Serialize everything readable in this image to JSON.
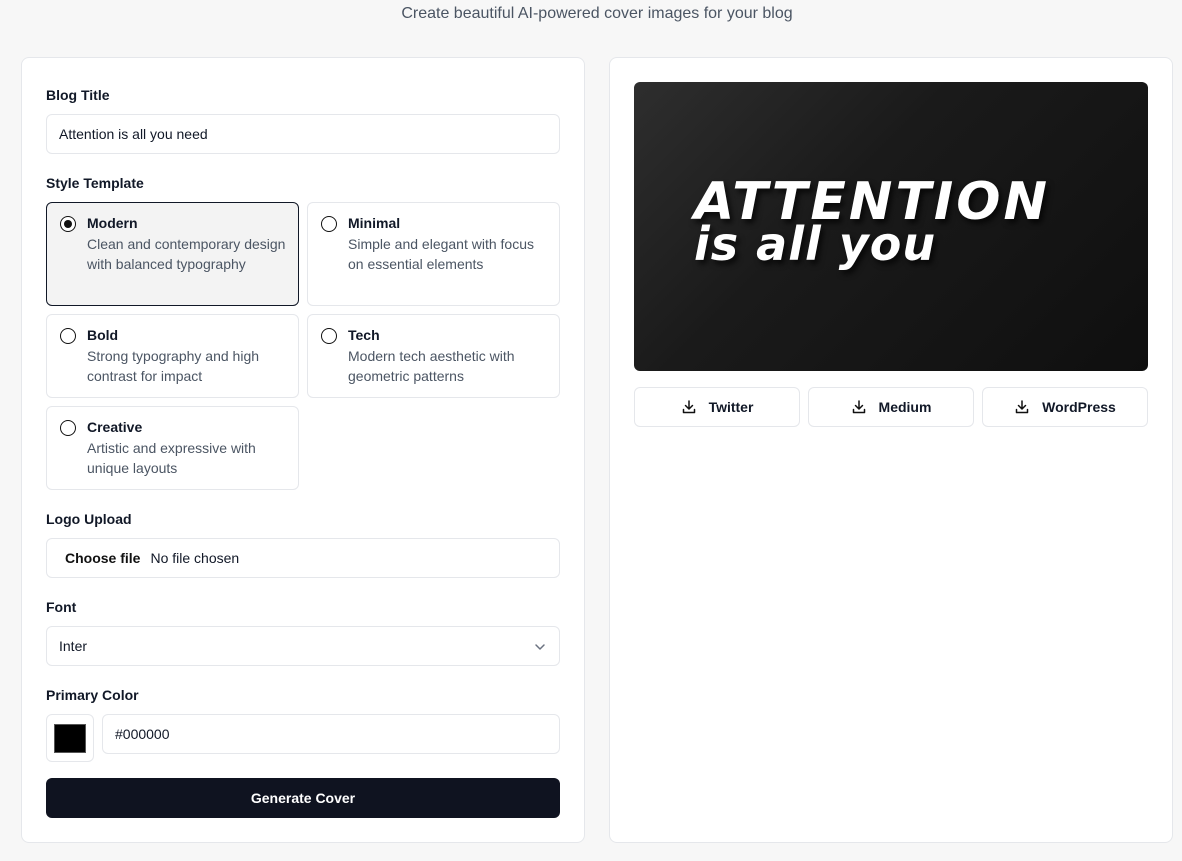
{
  "header": {
    "subtitle": "Create beautiful AI-powered cover images for your blog"
  },
  "form": {
    "blog_title_label": "Blog Title",
    "blog_title_value": "Attention is all you need",
    "style_template_label": "Style Template",
    "templates": [
      {
        "name": "Modern",
        "description": "Clean and contemporary design with balanced typography",
        "selected": true
      },
      {
        "name": "Minimal",
        "description": "Simple and elegant with focus on essential elements",
        "selected": false
      },
      {
        "name": "Bold",
        "description": "Strong typography and high contrast for impact",
        "selected": false
      },
      {
        "name": "Tech",
        "description": "Modern tech aesthetic with geometric patterns",
        "selected": false
      },
      {
        "name": "Creative",
        "description": "Artistic and expressive with unique layouts",
        "selected": false
      }
    ],
    "logo_upload_label": "Logo Upload",
    "file_button": "Choose file",
    "file_status": "No file chosen",
    "font_label": "Font",
    "font_value": "Inter",
    "primary_color_label": "Primary Color",
    "primary_color_value": "#000000",
    "generate_button": "Generate Cover"
  },
  "preview": {
    "line1": "ATTENTION",
    "line2": "is all you",
    "downloads": [
      {
        "label": "Twitter",
        "icon": "download-icon"
      },
      {
        "label": "Medium",
        "icon": "download-icon"
      },
      {
        "label": "WordPress",
        "icon": "download-icon"
      }
    ]
  },
  "colors": {
    "primary_button": "#0f1320",
    "border": "#e5e7eb",
    "swatch": "#000000"
  }
}
